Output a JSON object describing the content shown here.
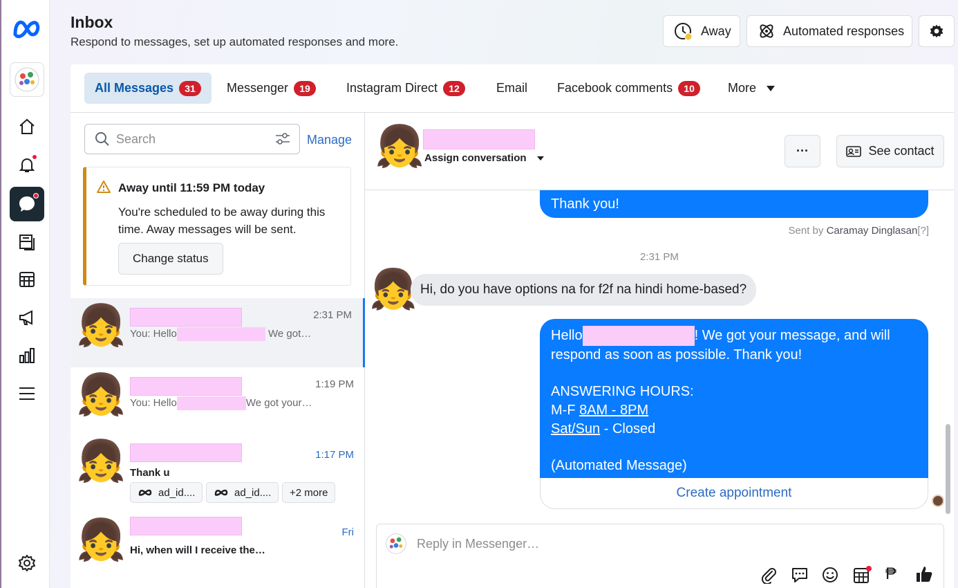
{
  "header": {
    "title": "Inbox",
    "subtitle": "Respond to messages, set up automated responses and more.",
    "away_button": "Away",
    "automated_button": "Automated responses"
  },
  "tabs": [
    {
      "label": "All Messages",
      "count": "31"
    },
    {
      "label": "Messenger",
      "count": "19"
    },
    {
      "label": "Instagram Direct",
      "count": "12"
    },
    {
      "label": "Email",
      "count": ""
    },
    {
      "label": "Facebook comments",
      "count": "10"
    },
    {
      "label": "More",
      "count": ""
    }
  ],
  "search": {
    "placeholder": "Search",
    "manage": "Manage"
  },
  "away_card": {
    "title": "Away until 11:59 PM today",
    "body": "You're scheduled to be away during this time. Away messages will be sent.",
    "button": "Change status"
  },
  "conversations": [
    {
      "emoji": "👧",
      "time": "2:31 PM",
      "snippet_pre": "You: Hello",
      "snippet_post": "We got…"
    },
    {
      "emoji": "👧",
      "time": "1:19 PM",
      "snippet_pre": "You: Hello",
      "snippet_post": "We got your…"
    },
    {
      "emoji": "👧",
      "time": "1:17 PM",
      "snippet_pre": "Thank u",
      "snippet_post": "",
      "chips": [
        "ad_id....",
        "ad_id....",
        "+2 more"
      ]
    },
    {
      "emoji": "👧",
      "time": "Fri",
      "snippet_pre": "Hi, when will I receive the…",
      "snippet_post": ""
    }
  ],
  "chat": {
    "assign": "Assign conversation",
    "see_contact": "See contact",
    "more_glyph": "···",
    "msg_thanks": "Thank you!",
    "sent_by_prefix": "Sent by ",
    "sent_by_name": "Caramay Dinglasan",
    "sent_by_suffix": "[?]",
    "timestamp": "2:31 PM",
    "incoming": "Hi, do you have options na for f2f na hindi home-based?",
    "auto_hello": "Hello",
    "auto_line1_rest": "! We got your message, and will",
    "auto_line2": "respond as soon as possible. Thank you!",
    "auto_hours_title": "ANSWERING HOURS:",
    "auto_mf": "M-F ",
    "auto_mf_hours": "8AM - 8PM",
    "auto_sat": "Sat/Sun",
    "auto_closed": " - Closed",
    "auto_tag": "(Automated Message)",
    "create_appointment": "Create appointment",
    "reply_placeholder": "Reply in Messenger…"
  },
  "icons": {
    "peso_glyph": "₱"
  },
  "colors": {
    "accent": "#0a7cff",
    "badge": "#d0202c",
    "active_tab_bg": "#dbe7f2",
    "away_border": "#d08a14"
  }
}
